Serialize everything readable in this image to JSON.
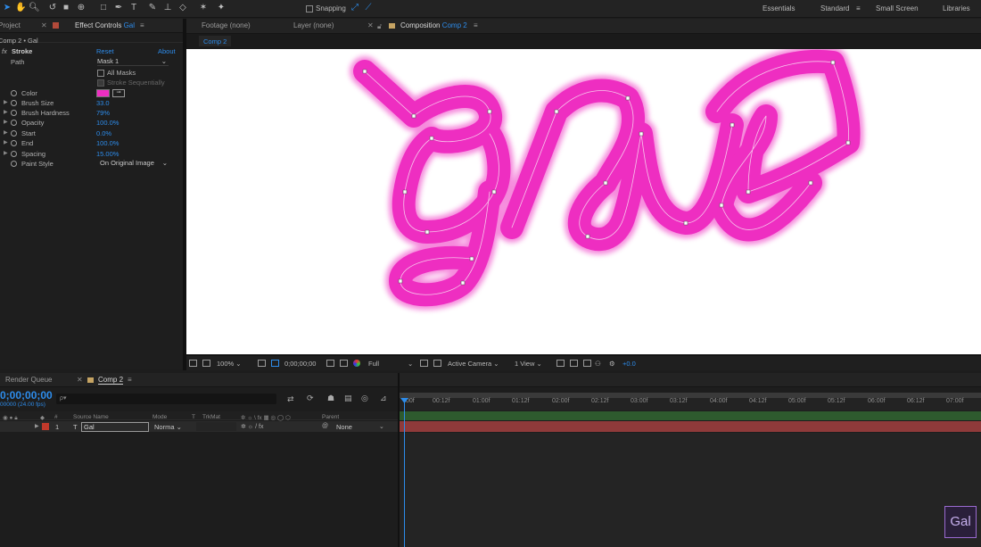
{
  "toolbar": {
    "snapping_label": "Snapping",
    "workspaces": [
      "Essentials",
      "Standard",
      "Small Screen",
      "Libraries"
    ],
    "active_workspace": "Standard"
  },
  "left_panel": {
    "tab_project": "Project",
    "tab_effect_controls_prefix": "Effect Controls",
    "tab_effect_controls_layer": "Gal",
    "breadcrumb": "Comp 2 • Gal",
    "effect_name": "Stroke",
    "reset_label": "Reset",
    "about_label": "About",
    "path_label": "Path",
    "path_value": "Mask 1",
    "all_masks_label": "All Masks",
    "stroke_seq_label": "Stroke Sequentially",
    "color_label": "Color",
    "color_value": "#ee2ec1",
    "properties": [
      {
        "label": "Brush Size",
        "value": "33.0"
      },
      {
        "label": "Brush Hardness",
        "value": "79%"
      },
      {
        "label": "Opacity",
        "value": "100.0%"
      },
      {
        "label": "Start",
        "value": "0.0%"
      },
      {
        "label": "End",
        "value": "100.0%"
      },
      {
        "label": "Spacing",
        "value": "15.00%"
      }
    ],
    "paint_style_label": "Paint Style",
    "paint_style_value": "On Original Image"
  },
  "viewer": {
    "tab_footage": "Footage (none)",
    "tab_layer": "Layer (none)",
    "tab_composition_prefix": "Composition",
    "tab_composition_name": "Comp 2",
    "comp_chip": "Comp 2",
    "zoom": "100%",
    "timecode": "0;00;00;00",
    "resolution": "Full",
    "camera": "Active Camera",
    "views": "1 View",
    "exposure": "+0.0"
  },
  "timeline": {
    "tab_render_queue": "Render Queue",
    "tab_comp": "Comp 2",
    "current_time": "0;00;00;00",
    "frame_info": "00000 (24.00 fps)",
    "search_placeholder": "",
    "ruler_ticks": [
      "00f",
      "00:12f",
      "01:00f",
      "01:12f",
      "02:00f",
      "02:12f",
      "03:00f",
      "03:12f",
      "04:00f",
      "04:12f",
      "05:00f",
      "05:12f",
      "06:00f",
      "06:12f",
      "07:00f"
    ],
    "col_source_name": "Source Name",
    "col_mode": "Mode",
    "col_t": "T",
    "col_trkmat": "TrkMat",
    "col_parent": "Parent",
    "layer": {
      "index": "1",
      "type": "T",
      "name": "Gal",
      "mode": "Norma",
      "parent": "None"
    }
  },
  "watermark": "Gal",
  "colors": {
    "accent": "#2d8ceb",
    "stroke": "#ee2ec1",
    "layer_bar": "#8f3a3a",
    "layer_label": "#c0392b"
  }
}
